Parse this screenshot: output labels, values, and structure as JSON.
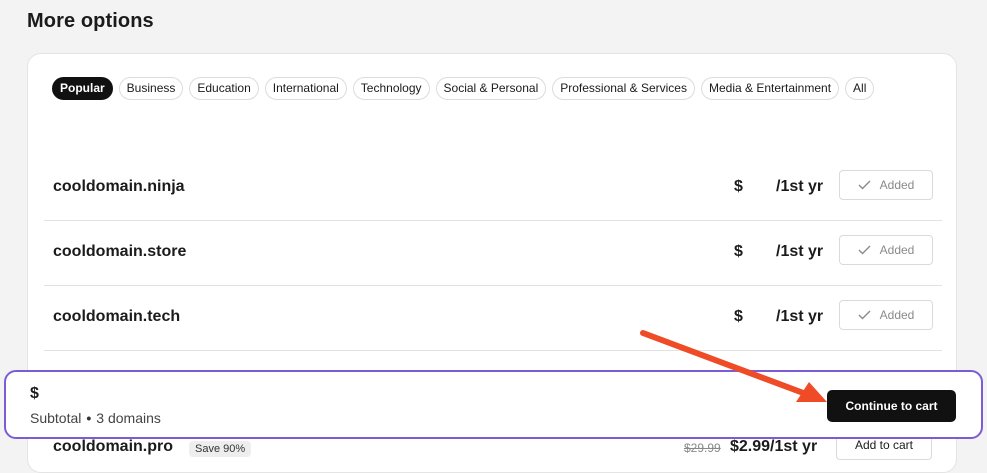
{
  "section_title": "More options",
  "filters": [
    {
      "label": "Popular",
      "active": true
    },
    {
      "label": "Business",
      "active": false
    },
    {
      "label": "Education",
      "active": false
    },
    {
      "label": "International",
      "active": false
    },
    {
      "label": "Technology",
      "active": false
    },
    {
      "label": "Social & Personal",
      "active": false
    },
    {
      "label": "Professional & Services",
      "active": false
    },
    {
      "label": "Media & Entertainment",
      "active": false
    },
    {
      "label": "All",
      "active": false
    }
  ],
  "domains": [
    {
      "name": "cooldomain.ninja",
      "currency": "$",
      "period": "/1st yr",
      "button": "Added"
    },
    {
      "name": "cooldomain.store",
      "currency": "$",
      "period": "/1st yr",
      "button": "Added"
    },
    {
      "name": "cooldomain.tech",
      "currency": "$",
      "period": "/1st yr",
      "button": "Added"
    },
    {
      "name": "",
      "currency": "",
      "period": "",
      "button": ""
    },
    {
      "name": "cooldomain.pro",
      "badge": "Save 90%",
      "old_price": "$29.99",
      "price": "$2.99/1st yr",
      "button": "Add to cart"
    }
  ],
  "cart": {
    "total": "$",
    "subtotal_label": "Subtotal",
    "domain_count": "3 domains",
    "continue_label": "Continue to cart"
  },
  "colors": {
    "cart_border": "#7b5cd6",
    "annotation_arrow": "#ee4b26",
    "primary_button": "#111111"
  }
}
